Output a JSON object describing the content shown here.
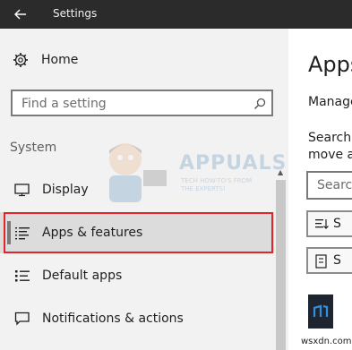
{
  "window": {
    "title": "Settings",
    "back_icon": "arrow-left-icon"
  },
  "sidebar": {
    "home_label": "Home",
    "search_placeholder": "Find a setting",
    "section_label": "System",
    "items": [
      {
        "label": "Display",
        "icon": "monitor-icon",
        "selected": false
      },
      {
        "label": "Apps & features",
        "icon": "list-icon",
        "selected": true
      },
      {
        "label": "Default apps",
        "icon": "list-check-icon",
        "selected": false
      },
      {
        "label": "Notifications & actions",
        "icon": "speech-bubble-icon",
        "selected": false
      }
    ]
  },
  "content": {
    "title": "Apps",
    "manage_text": "Manage",
    "search_line1": "Search,",
    "search_line2": "move a",
    "search_placeholder": "Search",
    "buttons": [
      {
        "label": "S",
        "icon": "sort-icon"
      },
      {
        "label": "S",
        "icon": "filter-icon"
      }
    ]
  },
  "watermark": {
    "name": "APPUALS",
    "tagline_1": "TECH HOW-TO'S FROM",
    "tagline_2": "THE EXPERTS!"
  },
  "footer": {
    "site": "wsxdn.com"
  },
  "colors": {
    "titlebar": "#2b2b2b",
    "sidebar_bg": "#f2f2f2",
    "selected_bg": "#dcdcdc",
    "highlight_border": "#e2252c"
  }
}
